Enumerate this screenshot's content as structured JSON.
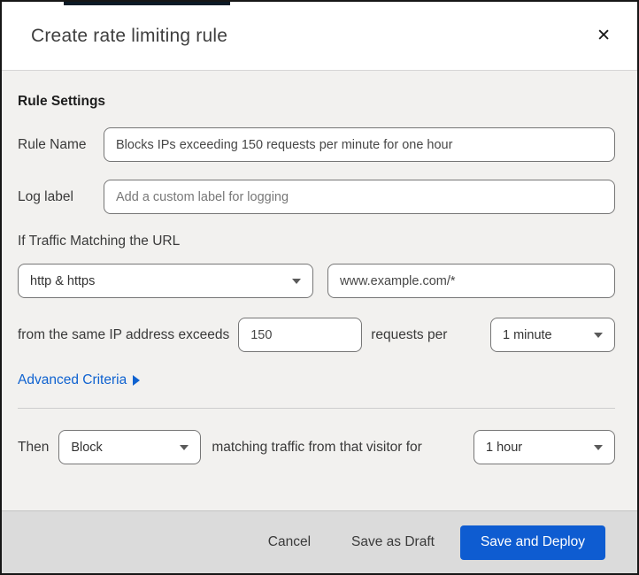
{
  "dialog": {
    "title": "Create rate limiting rule",
    "close_glyph": "✕"
  },
  "rule_settings": {
    "heading": "Rule Settings",
    "rule_name_label": "Rule Name",
    "rule_name_value": "Blocks IPs exceeding 150 requests per minute for one hour",
    "log_label_label": "Log label",
    "log_label_placeholder": "Add a custom label for logging"
  },
  "match": {
    "heading": "If Traffic Matching the URL",
    "scheme_value": "http & https",
    "url_value": "www.example.com/*",
    "exceeds_prefix": "from the same IP address exceeds",
    "requests_value": "150",
    "requests_per_text": "requests per",
    "period_value": "1 minute",
    "advanced_link": "Advanced Criteria"
  },
  "action": {
    "then_label": "Then",
    "action_value": "Block",
    "middle_text": "matching traffic from that visitor for",
    "duration_value": "1 hour"
  },
  "footer": {
    "cancel": "Cancel",
    "save_draft": "Save as Draft",
    "save_deploy": "Save and Deploy"
  },
  "colors": {
    "primary_button": "#0e5cd1",
    "link_blue": "#0f62d0",
    "body_background": "#f2f1ef",
    "footer_background": "#dbdbdb"
  }
}
